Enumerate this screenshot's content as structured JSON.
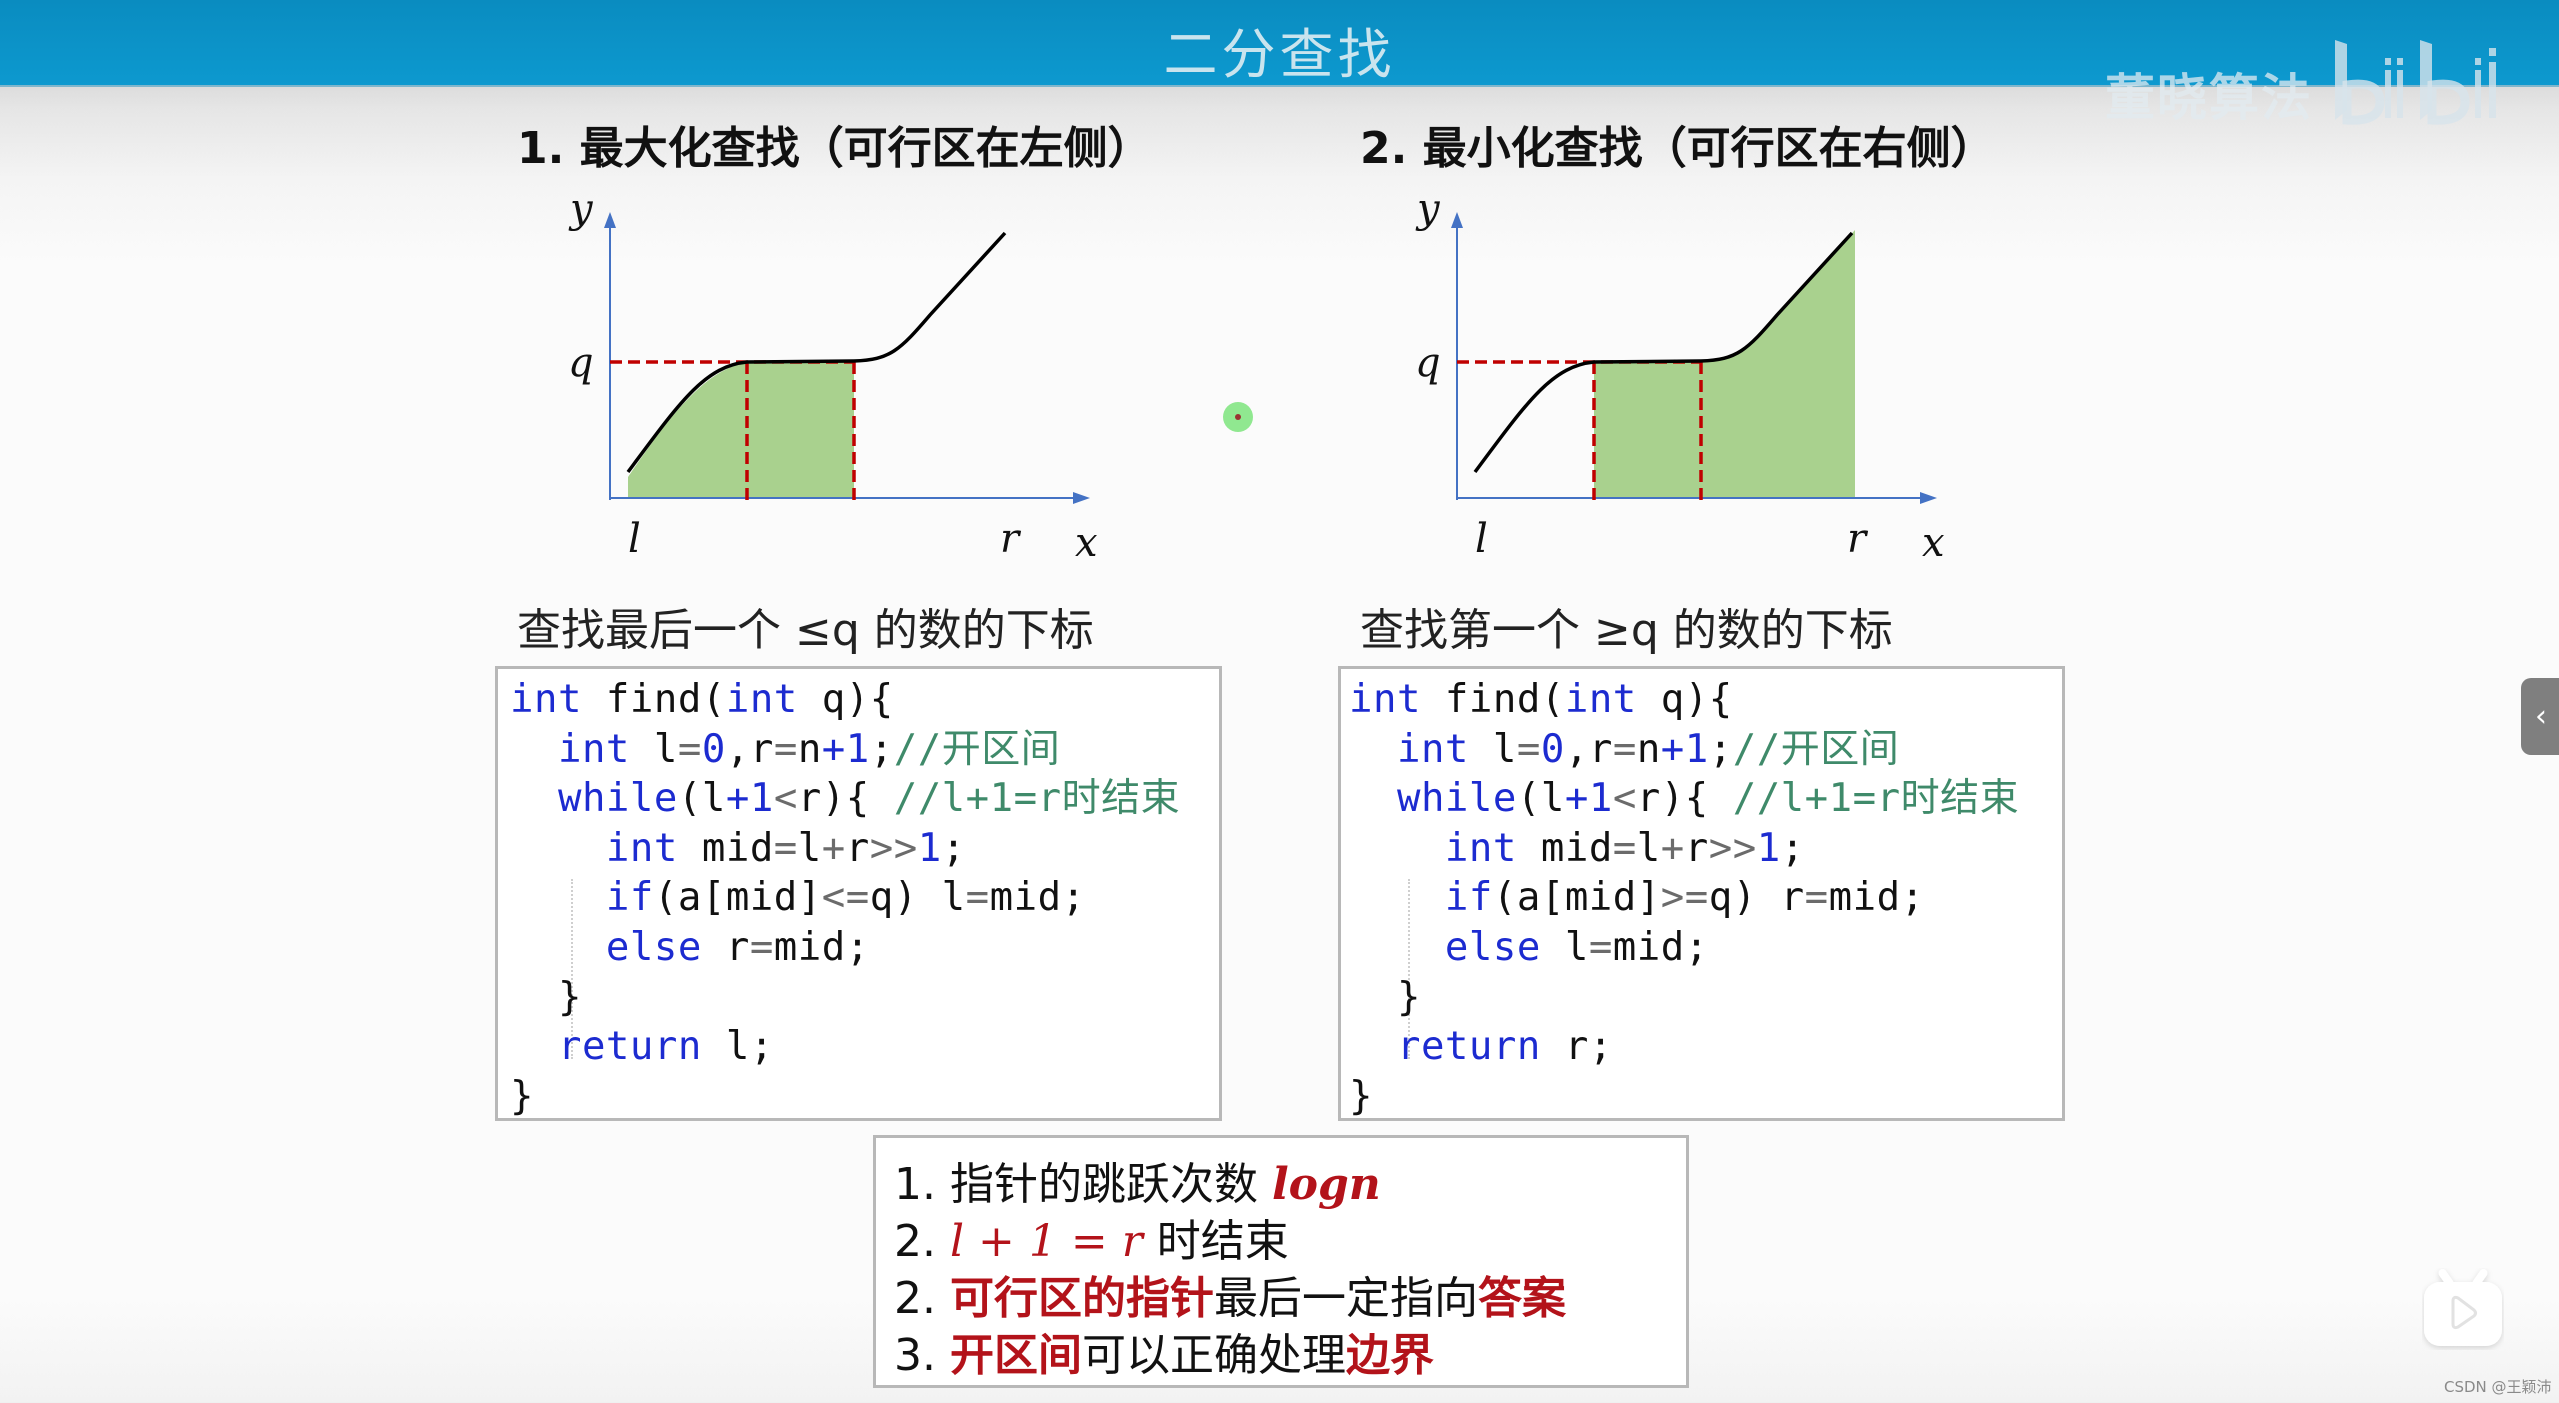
{
  "header": {
    "title": "二分查找",
    "watermark_text": "董晓算法",
    "logo": "bilibili-logo"
  },
  "sections": [
    {
      "heading": "1. 最大化查找（可行区在左侧）",
      "subtitle": "查找最后一个 ≤q 的数的下标",
      "graph": {
        "axis_labels": {
          "y": "y",
          "x": "x",
          "q": "q",
          "l": "l",
          "r": "r"
        },
        "shaded_region": "left",
        "colors": {
          "fill": "#a9d18e",
          "axis": "#4472c4",
          "dash": "#c00000",
          "curve": "#000000"
        }
      },
      "code": [
        "int find(int q){",
        "  int l=0,r=n+1;//开区间",
        "  while(l+1<r){ //l+1=r时结束",
        "    int mid=l+r>>1;",
        "    if(a[mid]<=q) l=mid;",
        "    else r=mid;",
        "  }",
        "  return l;",
        "}"
      ]
    },
    {
      "heading": "2. 最小化查找（可行区在右侧）",
      "subtitle": "查找第一个 ≥q 的数的下标",
      "graph": {
        "axis_labels": {
          "y": "y",
          "x": "x",
          "q": "q",
          "l": "l",
          "r": "r"
        },
        "shaded_region": "right",
        "colors": {
          "fill": "#a9d18e",
          "axis": "#4472c4",
          "dash": "#c00000",
          "curve": "#000000"
        }
      },
      "code": [
        "int find(int q){",
        "  int l=0,r=n+1;//开区间",
        "  while(l+1<r){ //l+1=r时结束",
        "    int mid=l+r>>1;",
        "    if(a[mid]>=q) r=mid;",
        "    else l=mid;",
        "  }",
        "  return r;",
        "}"
      ]
    }
  ],
  "notes": {
    "n1_prefix": "1. 指针的跳跃次数 ",
    "n1_math": "logn",
    "n2_prefix": "2. ",
    "n2_math": "l + 1 = r",
    "n2_suffix": " 时结束",
    "n3_prefix": "2. ",
    "n3_red1": "可行区的指针",
    "n3_mid": "最后一定指向",
    "n3_red2": "答案",
    "n4_prefix": "3. ",
    "n4_red1": "开区间",
    "n4_mid": "可以正确处理",
    "n4_red2": "边界"
  },
  "overlay": {
    "side_tab_icon": "chevron-left-icon",
    "side_tab_glyph": "‹",
    "tv_icon": "bilibili-tv-play-icon",
    "csdn_watermark": "CSDN @王颖沛"
  }
}
